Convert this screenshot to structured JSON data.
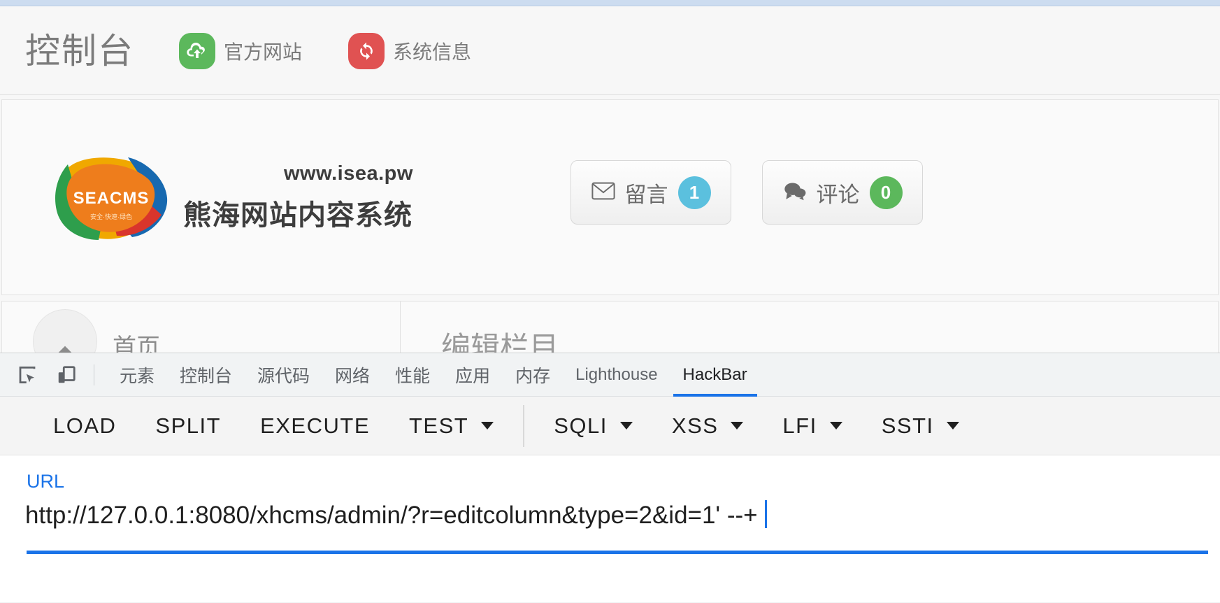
{
  "site": {
    "console_title": "控制台",
    "header_links": [
      {
        "label": "官方网站",
        "icon": "cloud-upload-icon",
        "color": "#5cb85c"
      },
      {
        "label": "系统信息",
        "icon": "refresh-icon",
        "color": "#e05252"
      }
    ],
    "logo": {
      "wordmark": "SEACMS",
      "tagline": "安全·快速·绿色"
    },
    "brand_url": "www.isea.pw",
    "brand_name": "熊海网站内容系统",
    "actions": [
      {
        "label": "留言",
        "icon": "envelope-icon",
        "count": "1",
        "badge_color": "#5bc0de"
      },
      {
        "label": "评论",
        "icon": "comment-icon",
        "count": "0",
        "badge_color": "#5cb85c"
      }
    ],
    "nav": {
      "home_label": "首页",
      "page_heading": "编辑栏目"
    }
  },
  "devtools": {
    "tools": [
      {
        "name": "inspect-element-icon"
      },
      {
        "name": "device-toolbar-icon"
      }
    ],
    "tabs": [
      {
        "label": "元素",
        "active": false
      },
      {
        "label": "控制台",
        "active": false
      },
      {
        "label": "源代码",
        "active": false
      },
      {
        "label": "网络",
        "active": false
      },
      {
        "label": "性能",
        "active": false
      },
      {
        "label": "应用",
        "active": false
      },
      {
        "label": "内存",
        "active": false
      },
      {
        "label": "Lighthouse",
        "active": false
      },
      {
        "label": "HackBar",
        "active": true
      }
    ],
    "active_tab": "HackBar",
    "accent_color": "#1a73e8"
  },
  "hackbar": {
    "buttons": [
      {
        "label": "LOAD",
        "dropdown": false
      },
      {
        "label": "SPLIT",
        "dropdown": false
      },
      {
        "label": "EXECUTE",
        "dropdown": false
      },
      {
        "label": "TEST",
        "dropdown": true
      },
      {
        "label": "SQLI",
        "dropdown": true
      },
      {
        "label": "XSS",
        "dropdown": true
      },
      {
        "label": "LFI",
        "dropdown": true
      },
      {
        "label": "SSTI",
        "dropdown": true
      }
    ],
    "url_label": "URL",
    "url_value": "http://127.0.0.1:8080/xhcms/admin/?r=editcolumn&type=2&id=1'  --+"
  }
}
